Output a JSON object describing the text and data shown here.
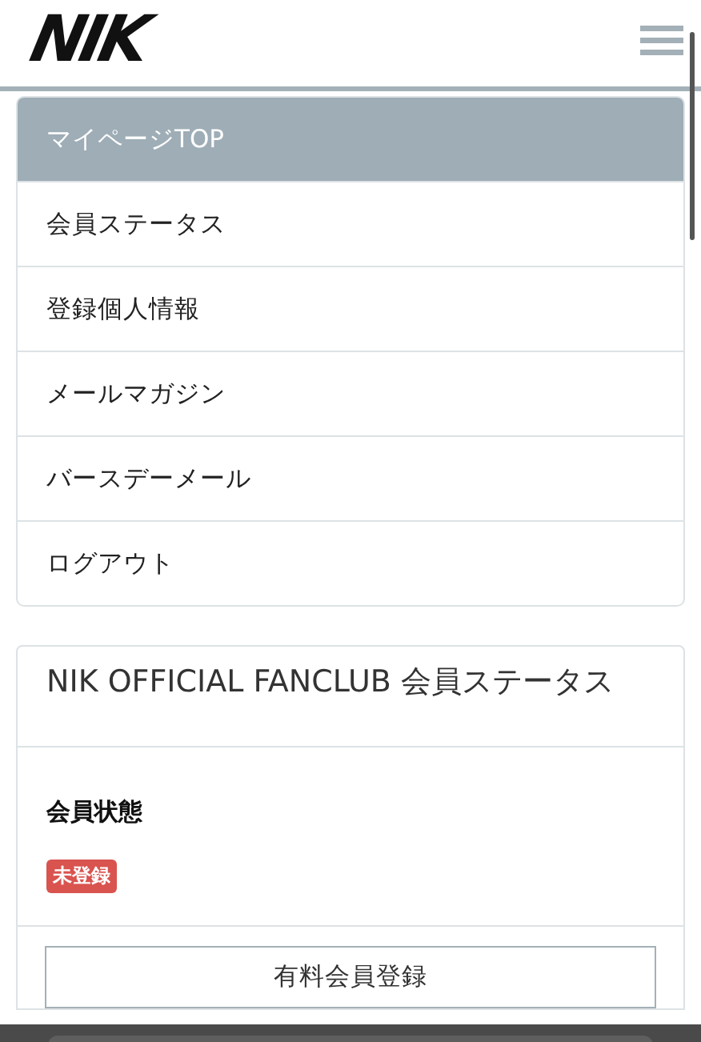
{
  "header": {
    "logo": "NIK"
  },
  "menu": {
    "items": [
      {
        "label": "マイページTOP",
        "selected": true
      },
      {
        "label": "会員ステータス",
        "selected": false
      },
      {
        "label": "登録個人情報",
        "selected": false
      },
      {
        "label": "メールマガジン",
        "selected": false
      },
      {
        "label": "バースデーメール",
        "selected": false
      },
      {
        "label": "ログアウト",
        "selected": false
      }
    ]
  },
  "status_card": {
    "title": "NIK OFFICIAL FANCLUB 会員ステータス",
    "field_label": "会員状態",
    "badge": "未登録",
    "button": "有料会員登録"
  }
}
